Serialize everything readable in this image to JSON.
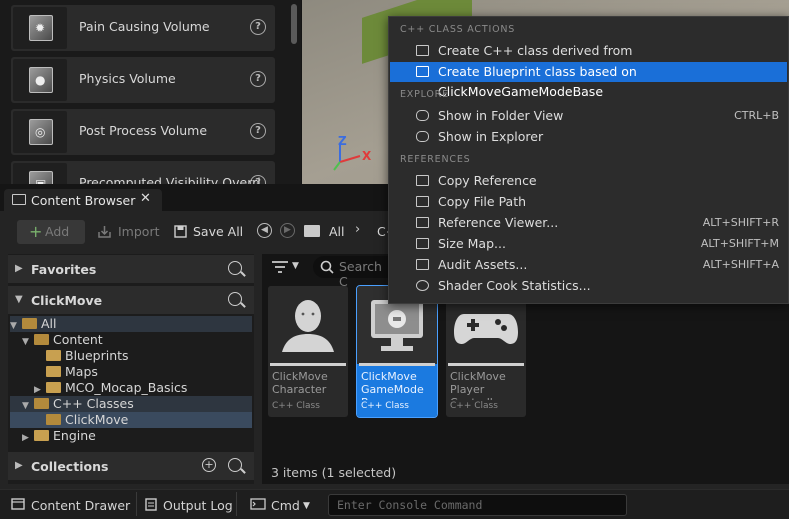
{
  "place_actors": {
    "items": [
      {
        "label": "Pain Causing Volume",
        "icon": "pain-volume-icon"
      },
      {
        "label": "Physics Volume",
        "icon": "physics-volume-icon"
      },
      {
        "label": "Post Process Volume",
        "icon": "post-process-volume-icon"
      },
      {
        "label": "Precomputed Visibility Overri",
        "icon": "visibility-volume-icon"
      }
    ],
    "help_glyph": "?"
  },
  "viewport": {
    "axis_z": "Z",
    "axis_x": "X"
  },
  "content_browser": {
    "tab_title": "Content Browser",
    "close_glyph": "✕",
    "toolbar": {
      "add": "Add",
      "import": "Import",
      "save_all": "Save All"
    },
    "breadcrumb": {
      "root": "All",
      "next": "C++"
    },
    "sections": {
      "favorites": "Favorites",
      "project": "ClickMove",
      "collections": "Collections"
    },
    "tree": [
      {
        "label": "All",
        "indent": 0,
        "expanded": true,
        "selected": false
      },
      {
        "label": "Content",
        "indent": 1,
        "expanded": true
      },
      {
        "label": "Blueprints",
        "indent": 2
      },
      {
        "label": "Maps",
        "indent": 2
      },
      {
        "label": "MCO_Mocap_Basics",
        "indent": 2,
        "collapsed": true
      },
      {
        "label": "C++ Classes",
        "indent": 1,
        "expanded": true
      },
      {
        "label": "ClickMove",
        "indent": 2,
        "selected": true
      },
      {
        "label": "Engine",
        "indent": 1,
        "collapsed": true
      }
    ],
    "search_placeholder": "Search C",
    "assets": [
      {
        "name": "ClickMove\nCharacter",
        "type": "C++ Class",
        "selected": false,
        "icon": "character-icon"
      },
      {
        "name": "ClickMove\nGameMode\nBase",
        "type": "C++ Class",
        "selected": true,
        "icon": "gamemode-icon"
      },
      {
        "name": "ClickMove\nPlayer\nController",
        "type": "C++ Class",
        "selected": false,
        "icon": "gamepad-icon"
      }
    ],
    "status": "3 items (1 selected)"
  },
  "bottom_bar": {
    "content_drawer": "Content Drawer",
    "output_log": "Output Log",
    "cmd": "Cmd",
    "console_placeholder": "Enter Console Command"
  },
  "context_menu": {
    "sections": {
      "cpp": "C++ CLASS ACTIONS",
      "explore": "EXPLORE",
      "references": "REFERENCES"
    },
    "items": {
      "create_cpp": {
        "label": "Create C++ class derived from ClickMoveGameModeBase"
      },
      "create_bp": {
        "label": "Create Blueprint class based on ClickMoveGameModeBase"
      },
      "folder_view": {
        "label": "Show in Folder View",
        "shortcut": "CTRL+B"
      },
      "explorer": {
        "label": "Show in Explorer"
      },
      "copy_ref": {
        "label": "Copy Reference"
      },
      "copy_path": {
        "label": "Copy File Path"
      },
      "ref_viewer": {
        "label": "Reference Viewer...",
        "shortcut": "ALT+SHIFT+R"
      },
      "size_map": {
        "label": "Size Map...",
        "shortcut": "ALT+SHIFT+M"
      },
      "audit": {
        "label": "Audit Assets...",
        "shortcut": "ALT+SHIFT+A"
      },
      "shader": {
        "label": "Shader Cook Statistics..."
      }
    }
  }
}
